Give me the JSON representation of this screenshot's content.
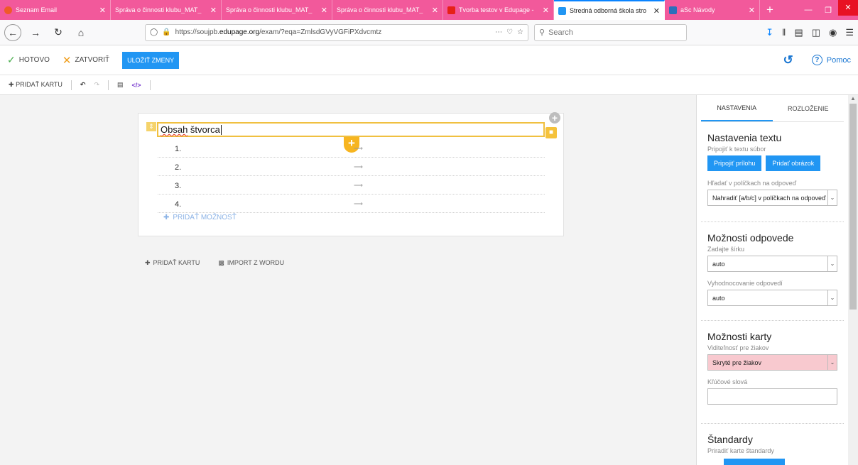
{
  "browser": {
    "tabs": [
      {
        "label": "Seznam Email",
        "fav_color": "#f05a28"
      },
      {
        "label": "Správa o činnosti klubu_MAT_",
        "fav_color": ""
      },
      {
        "label": "Správa o činnosti klubu_MAT_",
        "fav_color": ""
      },
      {
        "label": "Správa o činnosti klubu_MAT_",
        "fav_color": ""
      },
      {
        "label": "Tvorba testov v Edupage -",
        "fav_color": "#e62117"
      },
      {
        "label": "Stredná odborná škola stro",
        "fav_color": "#2196f3"
      },
      {
        "label": "aSc Návody",
        "fav_color": "#2c6fbb"
      }
    ],
    "url_prefix": "https://soujpb.",
    "url_domain": "edupage.org",
    "url_rest": "/exam/?eqa=ZmlsdGVyVGFiPXdvcmtz",
    "search_placeholder": "Search"
  },
  "toolbar": {
    "done_label": "HOTOVO",
    "close_label": "ZATVORIŤ",
    "save_label": "ULOŽIŤ ZMENY",
    "help_label": "Pomoc"
  },
  "subtoolbar": {
    "add_card_label": "PRIDAŤ KARTU"
  },
  "question": {
    "title_misspelled": "Obsah",
    "title_rest": " štvorca",
    "options": [
      "1.",
      "2.",
      "3.",
      "4."
    ],
    "add_option_label": "PRIDAŤ MOŽNOSŤ"
  },
  "canvas_actions": {
    "add_card_label": "PRIDAŤ KARTU",
    "import_word_label": "IMPORT Z WORDU"
  },
  "panel": {
    "tab_settings": "NASTAVENIA",
    "tab_layout": "ROZLOŽENIE",
    "text_settings_title": "Nastavenia textu",
    "attach_file_label": "Pripojiť k textu súbor",
    "attach_button": "Pripojiť prílohu",
    "add_image_button": "Pridať obrázok",
    "search_fields_label": "Hľadať v políčkach na odpoveď",
    "search_fields_value": "Nahradiť [a/b/c] v políčkach na odpoveď",
    "answer_options_title": "Možnosti odpovede",
    "width_label": "Zadajte šírku",
    "width_value": "auto",
    "eval_label": "Vyhodnocovanie odpovedí",
    "eval_value": "auto",
    "card_options_title": "Možnosti karty",
    "visibility_label": "Viditeľnosť pre žiakov",
    "visibility_value": "Skryté pre žiakov",
    "keywords_label": "Kľúčové slová",
    "keywords_value": "",
    "standards_title": "Štandardy",
    "assign_standards_label": "Priradiť karte štandardy"
  }
}
